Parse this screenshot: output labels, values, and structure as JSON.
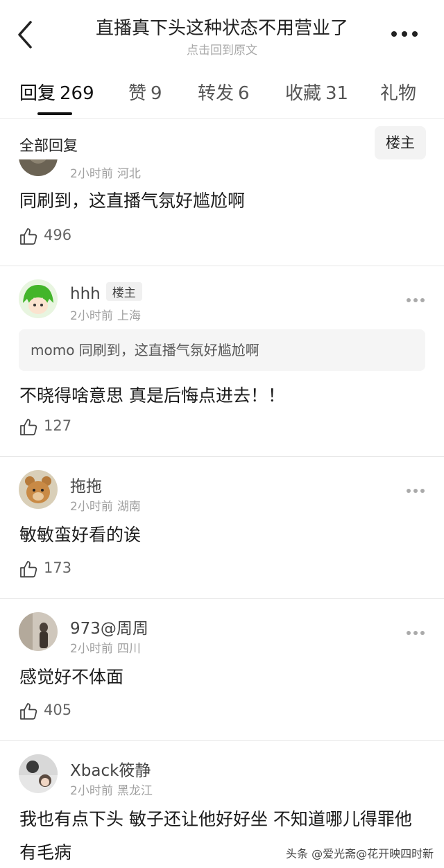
{
  "header": {
    "title": "直播真下头这种状态不用营业了",
    "subtitle": "点击回到原文"
  },
  "tabs": [
    {
      "label": "回复",
      "count": "269",
      "active": true
    },
    {
      "label": "赞",
      "count": "9"
    },
    {
      "label": "转发",
      "count": "6"
    },
    {
      "label": "收藏",
      "count": "31"
    },
    {
      "label": "礼物",
      "count": ""
    }
  ],
  "filter": {
    "label": "全部回复",
    "op_button": "楼主"
  },
  "comments": [
    {
      "meta_time": "2小时前",
      "meta_region": "河北",
      "text": "同刷到，这直播气氛好尴尬啊",
      "likes": "496"
    },
    {
      "username": "hhh",
      "op_tag": "楼主",
      "meta_time": "2小时前",
      "meta_region": "上海",
      "quote_user": "momo",
      "quote_text": "同刷到，这直播气氛好尴尬啊",
      "text": "不晓得啥意思 真是后悔点进去！！",
      "likes": "127"
    },
    {
      "username": "拖拖",
      "meta_time": "2小时前",
      "meta_region": "湖南",
      "text": "敏敏蛮好看的诶",
      "likes": "173"
    },
    {
      "username": "973@周周",
      "meta_time": "2小时前",
      "meta_region": "四川",
      "text": "感觉好不体面",
      "likes": "405"
    },
    {
      "username": "Xback筱静",
      "meta_time": "2小时前",
      "meta_region": "黑龙江",
      "text": "我也有点下头 敏子还让他好好坐 不知道哪儿得罪他有毛病"
    }
  ],
  "watermark": "头条 @爱光斋@花开映四时新",
  "icons": {
    "back": "chevron-left-icon",
    "more": "more-horizontal-icon",
    "like": "thumbs-up-icon"
  }
}
